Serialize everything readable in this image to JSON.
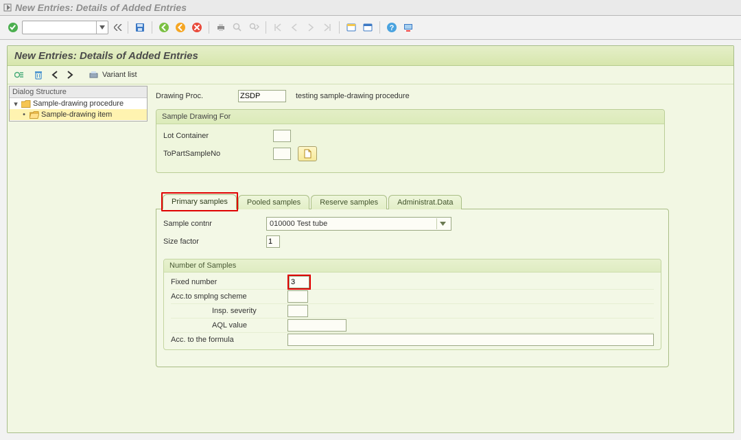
{
  "window": {
    "title": "New Entries: Details of Added Entries"
  },
  "panel": {
    "title": "New Entries: Details of Added Entries"
  },
  "subtoolbar": {
    "variant_list": "Variant list"
  },
  "tree": {
    "header": "Dialog Structure",
    "items": [
      {
        "label": "Sample-drawing procedure"
      },
      {
        "label": "Sample-drawing item"
      }
    ]
  },
  "header_fields": {
    "drawing_proc_label": "Drawing Proc.",
    "drawing_proc_value": "ZSDP",
    "drawing_proc_desc": "testing sample-drawing procedure"
  },
  "group_drawing_for": {
    "title": "Sample Drawing For",
    "lot_container_label": "Lot Container",
    "lot_container_value": "",
    "topart_label": "ToPartSampleNo",
    "topart_value": ""
  },
  "tabs": {
    "t1": "Primary samples",
    "t2": "Pooled samples",
    "t3": "Reserve samples",
    "t4": "Administrat.Data"
  },
  "primary": {
    "sample_contnr_label": "Sample contnr",
    "sample_contnr_value": "010000 Test tube",
    "size_factor_label": "Size factor",
    "size_factor_value": "1"
  },
  "num_samples": {
    "title": "Number of Samples",
    "fixed_number_label": "Fixed number",
    "fixed_number_value": "3",
    "acc_scheme_label": "Acc.to smplng scheme",
    "acc_scheme_value": "",
    "insp_severity_label": "Insp. severity",
    "insp_severity_value": "",
    "aql_label": "AQL value",
    "aql_value": "",
    "formula_label": "Acc. to the formula",
    "formula_value": ""
  },
  "colors": {
    "accent": "#8bc34a",
    "highlight": "#e00000"
  }
}
